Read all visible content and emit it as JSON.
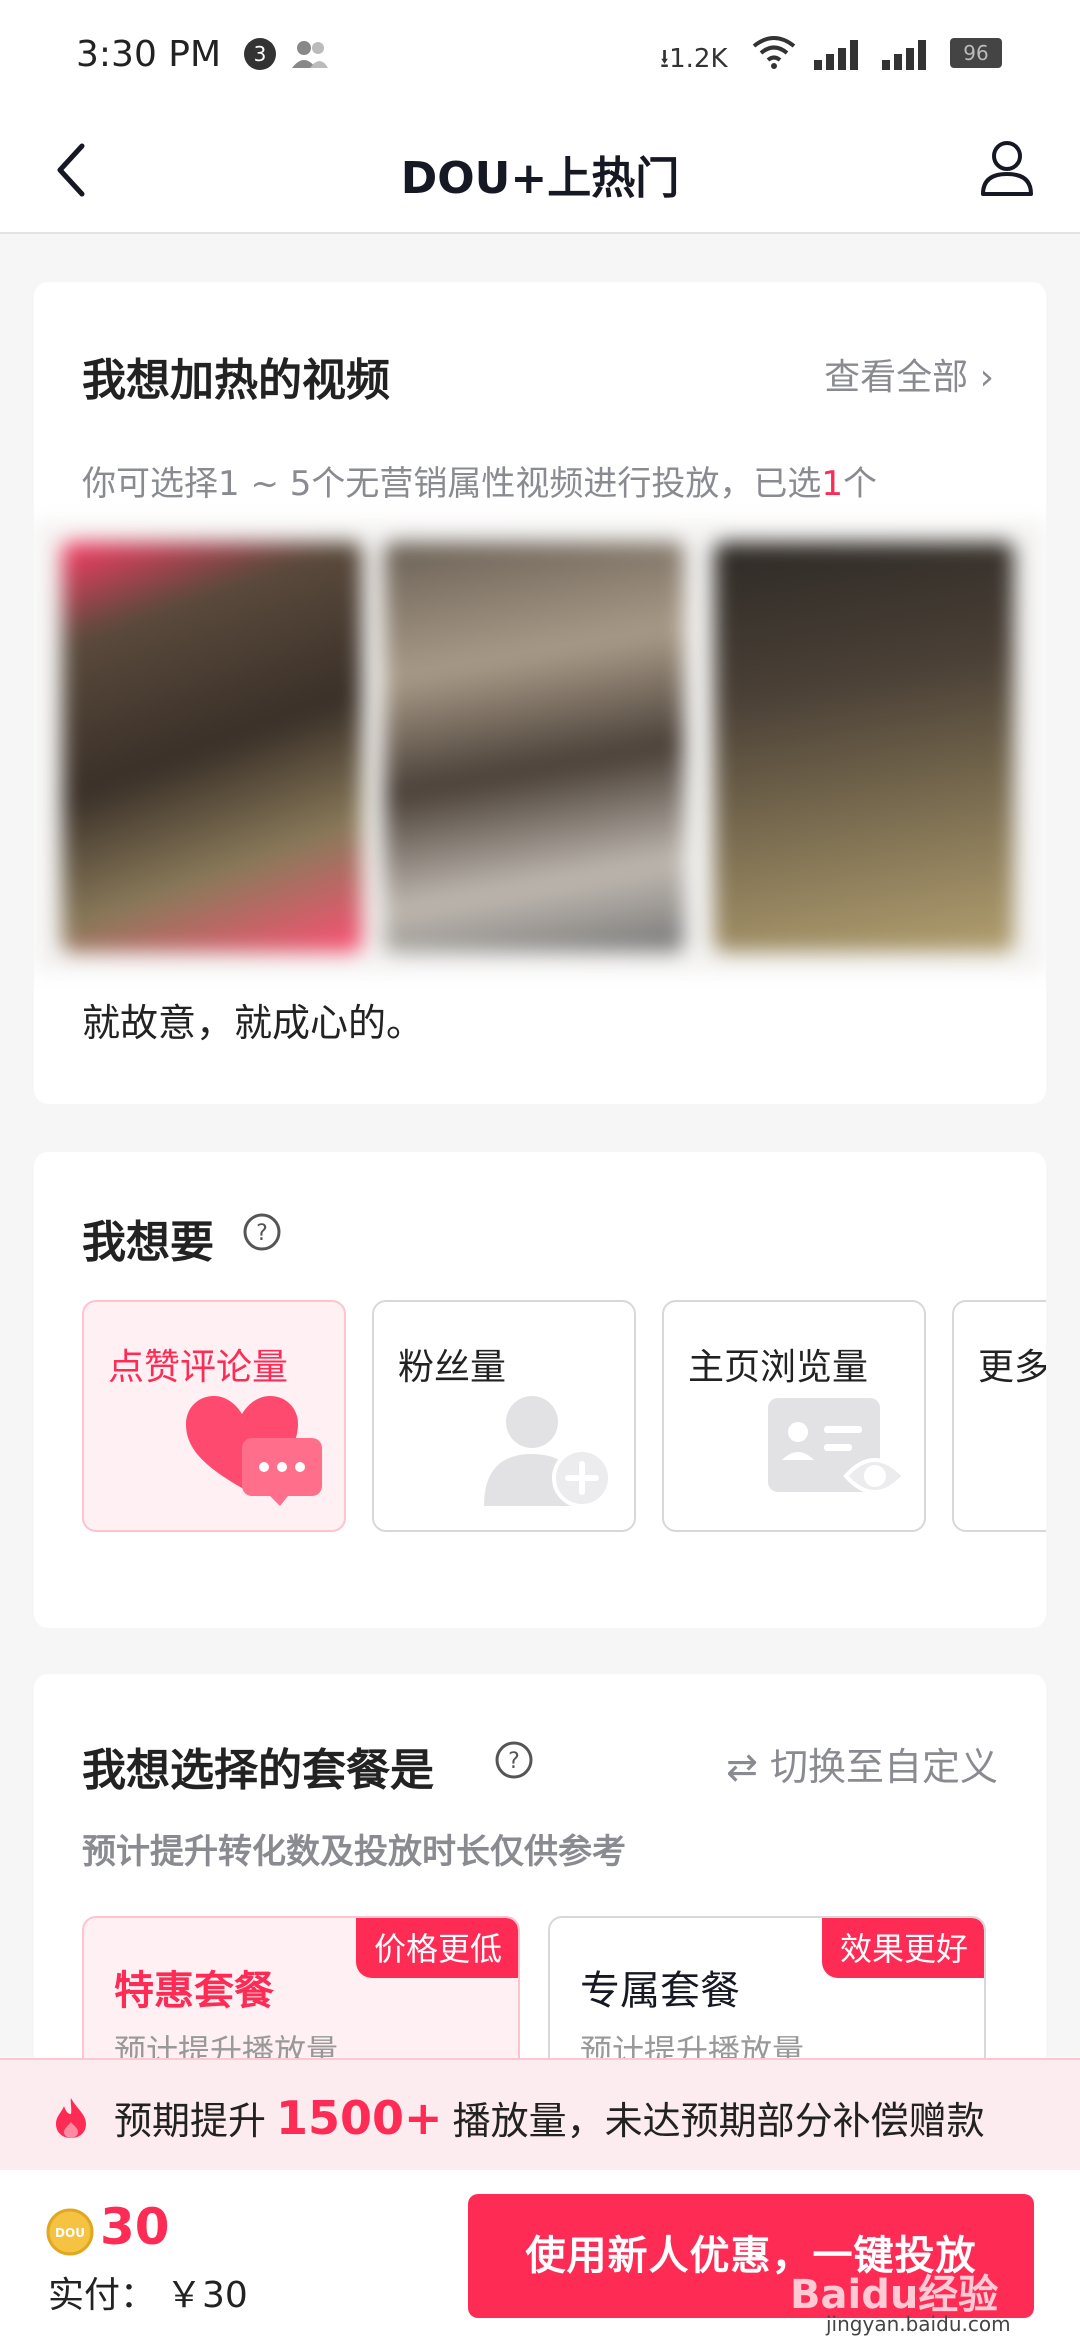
{
  "status_bar": {
    "time": "3:30 PM",
    "notification_count": "3",
    "network_speed": "1.2K",
    "battery": "96"
  },
  "nav": {
    "title": "DOU+上热门"
  },
  "videos": {
    "title": "我想加热的视频",
    "view_all": "查看全部",
    "hint_prefix": "你可选择1 ~ 5个无营销属性视频进行投放，已选",
    "hint_count": "1",
    "hint_suffix": "个",
    "caption": "就故意，就成心的。"
  },
  "want": {
    "title": "我想要",
    "options": [
      {
        "label": "点赞评论量",
        "selected": true,
        "icon": "heart-comment-icon"
      },
      {
        "label": "粉丝量",
        "selected": false,
        "icon": "add-follower-icon"
      },
      {
        "label": "主页浏览量",
        "selected": false,
        "icon": "profile-view-icon"
      },
      {
        "label": "更多",
        "selected": false,
        "icon": ""
      }
    ]
  },
  "package": {
    "title": "我想选择的套餐是",
    "switch_label": "切换至自定义",
    "hint": "预计提升转化数及投放时长仅供参考",
    "items": [
      {
        "name": "特惠套餐",
        "tag": "价格更低",
        "sub": "预计提升播放量",
        "selected": true
      },
      {
        "name": "专属套餐",
        "tag": "效果更好",
        "sub": "预计提升播放量",
        "selected": false
      }
    ]
  },
  "banner": {
    "prefix": "预期提升",
    "number": "1500+",
    "suffix": "播放量，未达预期部分补偿赠款"
  },
  "bottom": {
    "coin_label": "DOU",
    "coins": "30",
    "paid_label": "实付：",
    "paid_value": "￥30",
    "cta": "使用新人优惠，一键投放"
  },
  "watermark": {
    "brand": "Baidu经验",
    "url": "jingyan.baidu.com"
  },
  "colors": {
    "accent": "#fe2c55",
    "selected_bg": "#fff0f3",
    "muted_text": "#8a8b91"
  }
}
